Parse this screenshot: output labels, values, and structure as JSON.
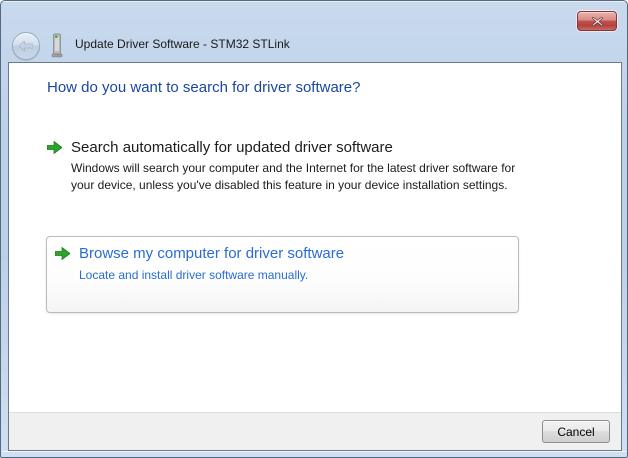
{
  "titlebar": {
    "title": "Update Driver Software - STM32 STLink"
  },
  "icons": {
    "close": "close-x",
    "back": "arrow-left",
    "device": "hardware-driver-device",
    "option_bullet": "green-arrow-right"
  },
  "content": {
    "heading": "How do you want to search for driver software?",
    "options": [
      {
        "title": "Search automatically for updated driver software",
        "description": "Windows will search your computer and the Internet for the latest driver software for your device, unless you've disabled this feature in your device installation settings.",
        "state": "normal"
      },
      {
        "title": "Browse my computer for driver software",
        "description": "Locate and install driver software manually.",
        "state": "highlighted"
      }
    ]
  },
  "footer": {
    "cancel_label": "Cancel"
  },
  "colors": {
    "heading_blue": "#19479E",
    "link_blue": "#2A6CD5",
    "arrow_green": "#1F9E1F",
    "close_red": "#C0504E",
    "glass_blue": "#BCD0E8",
    "footer_gray": "#F0F0F0"
  }
}
